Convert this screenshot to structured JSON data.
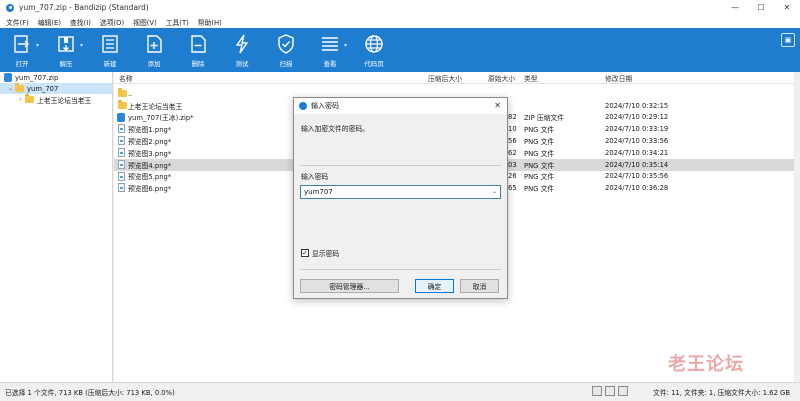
{
  "window": {
    "title": "yum_707.zip - Bandizip (Standard)",
    "controls": [
      "—",
      "☐",
      "✕"
    ]
  },
  "menu": [
    "文件(F)",
    "编辑(E)",
    "查找(I)",
    "选项(O)",
    "视图(V)",
    "工具(T)",
    "帮助(H)"
  ],
  "toolbar": {
    "buttons": [
      {
        "label": "打开",
        "icon": "open-icon"
      },
      {
        "label": "解压",
        "icon": "extract-icon"
      },
      {
        "label": "新建",
        "icon": "new-archive-icon"
      },
      {
        "label": "添加",
        "icon": "add-icon"
      },
      {
        "label": "删除",
        "icon": "delete-icon"
      },
      {
        "label": "测试",
        "icon": "test-icon"
      },
      {
        "label": "扫描",
        "icon": "scan-icon"
      },
      {
        "label": "查看",
        "icon": "view-icon"
      },
      {
        "label": "代码页",
        "icon": "codepage-icon"
      }
    ]
  },
  "sidebar": {
    "items": [
      {
        "label": "yum_707.zip",
        "level": 0
      },
      {
        "label": "yum_707",
        "level": 1,
        "selected": true
      },
      {
        "label": "上老王论坛当老王",
        "level": 2
      }
    ]
  },
  "filelist": {
    "headers": {
      "name": "名称",
      "compressed": "压缩后大小",
      "original": "原始大小",
      "type": "类型",
      "modified": "修改日期"
    },
    "rows": [
      {
        "name": "..",
        "original": "",
        "type": "",
        "modified": "",
        "kind": "folder"
      },
      {
        "name": "上老王论坛当老王",
        "original": "",
        "type": "",
        "modified": "2024/7/10 0:32:15",
        "kind": "folder"
      },
      {
        "name": "yum_707(王冰).zip*",
        "original": "82",
        "type": "ZIP 压缩文件",
        "modified": "2024/7/10 0:29:12",
        "kind": "zip"
      },
      {
        "name": "预览图1.png*",
        "original": "10",
        "type": "PNG 文件",
        "modified": "2024/7/10 0:33:19",
        "kind": "file"
      },
      {
        "name": "预览图2.png*",
        "original": "56",
        "type": "PNG 文件",
        "modified": "2024/7/10 0:33:56",
        "kind": "file"
      },
      {
        "name": "预览图3.png*",
        "original": "62",
        "type": "PNG 文件",
        "modified": "2024/7/10 0:34:21",
        "kind": "file"
      },
      {
        "name": "预览图4.png*",
        "original": "03",
        "type": "PNG 文件",
        "modified": "2024/7/10 0:35:14",
        "kind": "file",
        "selected": true
      },
      {
        "name": "预览图5.png*",
        "original": "26",
        "type": "PNG 文件",
        "modified": "2024/7/10 0:35:56",
        "kind": "file"
      },
      {
        "name": "预览图6.png*",
        "original": "65",
        "type": "PNG 文件",
        "modified": "2024/7/10 0:36:28",
        "kind": "file"
      }
    ]
  },
  "dialog": {
    "title": "输入密码",
    "message": "输入加密文件的密码。",
    "field_label": "输入密码",
    "password_value": "yum707",
    "show_password_label": "显示密码",
    "show_password_checked": true,
    "manager_button": "密码管理器...",
    "ok_button": "确定",
    "cancel_button": "取消"
  },
  "status": {
    "left": "已选择 1 个文件, 713 KB (压缩后大小: 713 KB, 0.0%)",
    "right": "文件: 11, 文件夹: 1, 压缩文件大小: 1.62 GB"
  },
  "watermark": "老王论坛"
}
